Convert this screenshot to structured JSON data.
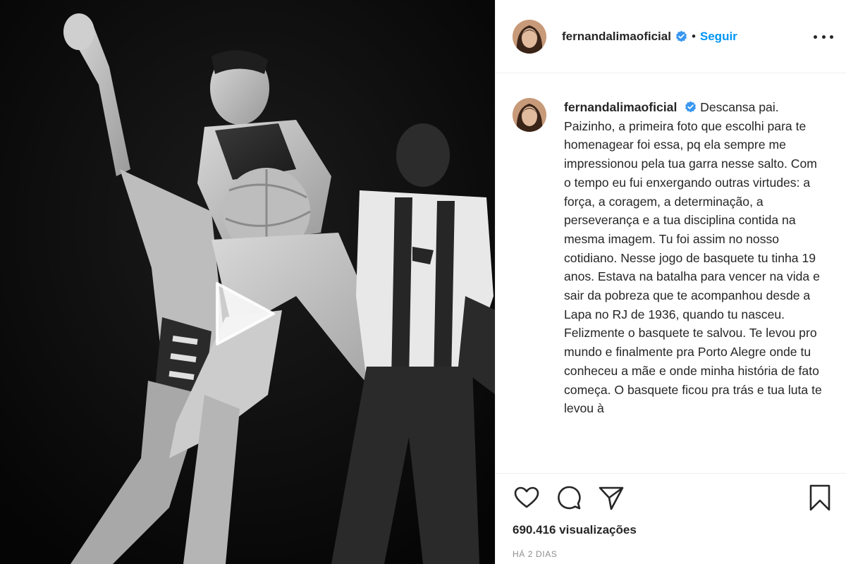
{
  "header": {
    "username": "fernandalimaoficial",
    "separator": "•",
    "follow_label": "Seguir"
  },
  "caption": {
    "username": "fernandalimaoficial",
    "text": "Descansa pai. Paizinho, a primeira foto que escolhi para te homenagear foi essa, pq ela sempre me impressionou pela tua garra nesse salto. Com o tempo eu fui enxergando outras virtudes: a força, a coragem, a determinação, a perseverança e a tua disciplina contida na mesma imagem. Tu foi assim no nosso cotidiano. Nesse jogo de basquete tu tinha 19 anos. Estava na batalha para vencer na vida e sair da pobreza que te acompanhou desde a Lapa no RJ de 1936, quando tu nasceu. Felizmente o basquete te salvou. Te levou pro mundo e finalmente pra Porto Alegre onde tu conheceu a mãe e onde minha história de fato começa. O basquete ficou pra trás e tua luta te levou à"
  },
  "actions": {
    "icons": [
      "heart-icon",
      "comment-icon",
      "share-icon",
      "bookmark-icon"
    ]
  },
  "stats": {
    "views": "690.416 visualizações"
  },
  "meta": {
    "time_ago": "HÁ 2 DIAS"
  },
  "colors": {
    "accent": "#0095f6",
    "verified": "#3897f0",
    "text": "#262626",
    "muted": "#8e8e8e",
    "divider": "#efefef"
  }
}
